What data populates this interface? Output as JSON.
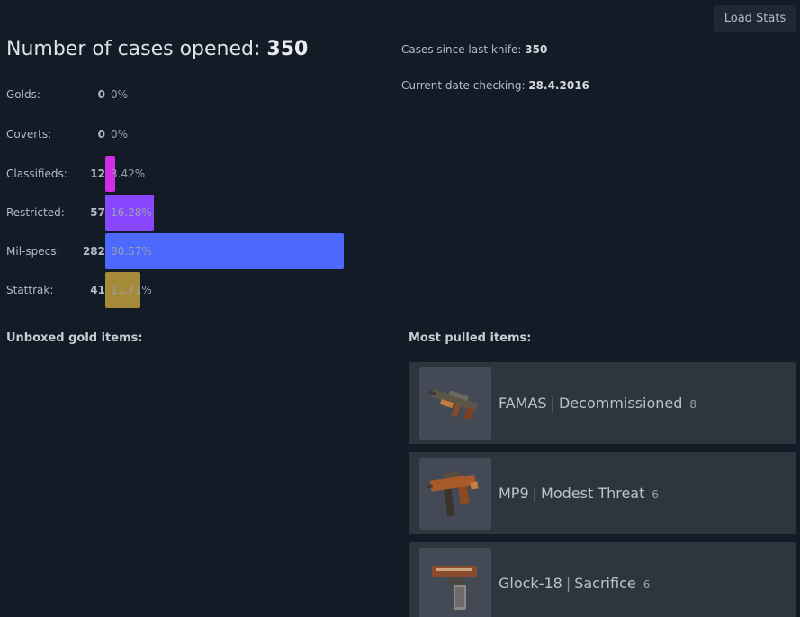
{
  "toolbar": {
    "load_label": "Load Stats"
  },
  "summary": {
    "title_prefix": "Number of cases opened:",
    "total": "350",
    "since_knife_label": "Cases since last knife:",
    "since_knife_value": "350",
    "date_label": "Current date checking:",
    "date_value": "28.4.2016"
  },
  "stats": [
    {
      "label": "Golds:",
      "count": "0",
      "pct": "0%",
      "fraction": 0.0,
      "color": "#e0c84a"
    },
    {
      "label": "Coverts:",
      "count": "0",
      "pct": "0%",
      "fraction": 0.0,
      "color": "#eb4b4b"
    },
    {
      "label": "Classifieds:",
      "count": "12",
      "pct": "3.42%",
      "fraction": 0.0342,
      "color": "#d32ce6"
    },
    {
      "label": "Restricted:",
      "count": "57",
      "pct": "16.28%",
      "fraction": 0.1628,
      "color": "#8847ff"
    },
    {
      "label": "Mil-specs:",
      "count": "282",
      "pct": "80.57%",
      "fraction": 0.8057,
      "color": "#4b69ff"
    },
    {
      "label": "Stattrak:",
      "count": "41",
      "pct": "11.71%",
      "fraction": 0.1171,
      "color": "#a58a3a"
    }
  ],
  "sections": {
    "gold_title": "Unboxed gold items:",
    "pulled_title": "Most pulled items:"
  },
  "pulled_items": [
    {
      "weapon": "FAMAS",
      "sep": "|",
      "skin": "Decommissioned",
      "count": "8",
      "icon": "famas-icon"
    },
    {
      "weapon": "MP9",
      "sep": "|",
      "skin": "Modest Threat",
      "count": "6",
      "icon": "mp9-icon"
    },
    {
      "weapon": "Glock-18",
      "sep": "|",
      "skin": "Sacrifice",
      "count": "6",
      "icon": "glock-icon"
    }
  ]
}
